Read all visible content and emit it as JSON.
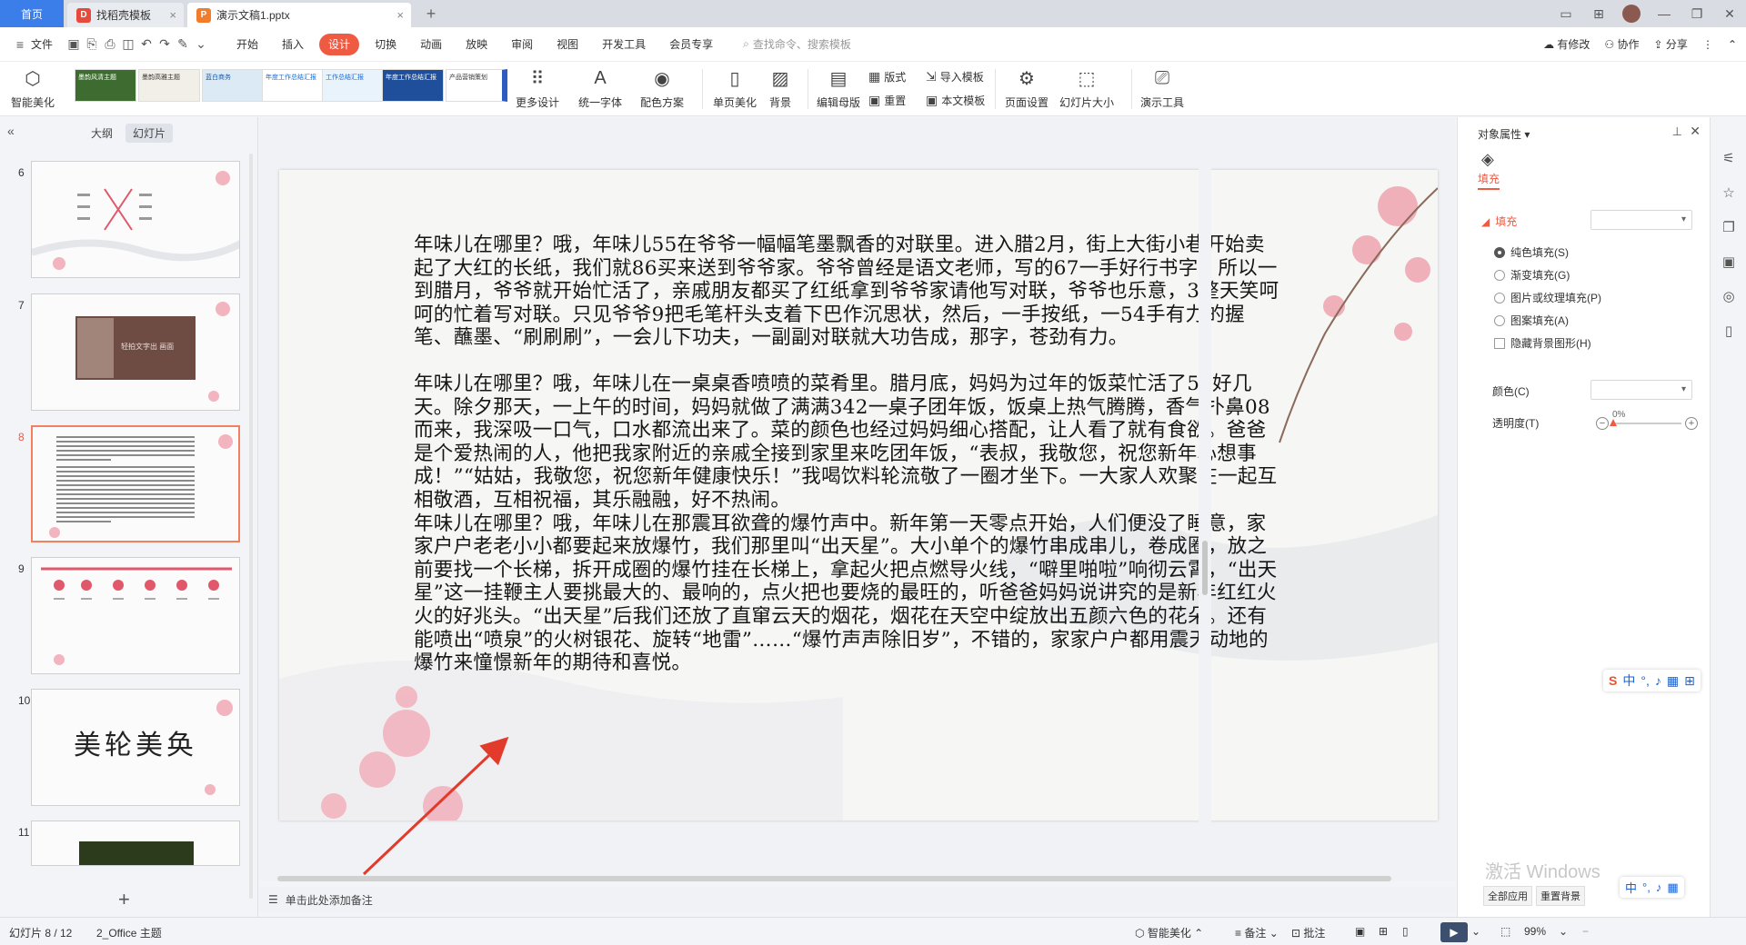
{
  "titlebar": {
    "tabs": [
      {
        "label": "首页"
      },
      {
        "label": "找稻壳模板"
      },
      {
        "label": "演示文稿1.pptx"
      }
    ]
  },
  "menu": {
    "file": "文件",
    "items": [
      "开始",
      "插入",
      "设计",
      "切换",
      "动画",
      "放映",
      "审阅",
      "视图",
      "开发工具",
      "会员专享"
    ],
    "active": "设计",
    "search_placeholder": "查找命令、搜索模板",
    "right": {
      "changes": "有修改",
      "collab": "协作",
      "share": "分享"
    }
  },
  "ribbon": {
    "smart_beautify": "智能美化",
    "template_thumbs": [
      "墨韵风清主题",
      "墨韵高雅主题",
      "蓝白商务",
      "年度工作总结汇报",
      "工作总结汇报",
      "年度工作总结汇报",
      "产品营销策划"
    ],
    "more_design": "更多设计",
    "unify_font": "统一字体",
    "color_scheme": "配色方案",
    "single_beautify": "单页美化",
    "background": "背景",
    "edit_master": "编辑母版",
    "layout": "版式",
    "reset": "重置",
    "import_template": "导入模板",
    "this_template": "本文模板",
    "page_setup": "页面设置",
    "slide_size": "幻灯片大小",
    "present_tools": "演示工具"
  },
  "left_panel": {
    "tab_outline": "大纲",
    "tab_slides": "幻灯片",
    "slides": [
      {
        "num": "6"
      },
      {
        "num": "7",
        "title": "轻拍文字出 画面"
      },
      {
        "num": "8",
        "selected": true
      },
      {
        "num": "9"
      },
      {
        "num": "10",
        "title": "美轮美奂"
      },
      {
        "num": "11"
      }
    ],
    "add": "+"
  },
  "slide": {
    "paragraphs": [
      "年味儿在哪里？哦，年味儿55在爷爷一幅幅笔墨飘香的对联里。进入腊2月，街上大街小巷开始卖起了大红的长纸，我们就86买来送到爷爷家。爷爷曾经是语文老师，写的67一手好行书字，所以一到腊月，爷爷就开始忙活了，亲戚朋友都买了红纸拿到爷爷家请他写对联，爷爷也乐意，3整天笑呵呵的忙着写对联。只见爷爷9把毛笔杆头支着下巴作沉思状，然后，一手按纸，一54手有力的握笔、蘸墨、“刷刷刷”，一会儿下功夫，一副副对联就大功告成，那字，苍劲有力。",
      "年味儿在哪里？哦，年味儿在一桌桌香喷喷的菜肴里。腊月底，妈妈为过年的饭菜忙活了56好几天。除夕那天，一上午的时间，妈妈就做了满满342一桌子团年饭，饭桌上热气腾腾，香气扑鼻08而来，我深吸一口气，口水都流出来了。菜的颜色也经过妈妈细心搭配，让人看了就有食欲。爸爸是个爱热闹的人，他把我家附近的亲戚全接到家里来吃团年饭，“表叔，我敬您，祝您新年心想事成！”“姑姑，我敬您，祝您新年健康快乐！”我喝饮料轮流敬了一圈才坐下。一大家人欢聚在一起互相敬酒，互相祝福，其乐融融，好不热闹。",
      "年味儿在哪里？哦，年味儿在那震耳欲聋的爆竹声中。新年第一天零点开始，人们便没了睡意，家家户户老老小小都要起来放爆竹，我们那里叫“出天星”。大小单个的爆竹串成串儿，卷成圈，放之前要找一个长梯，拆开成圈的爆竹挂在长梯上，拿起火把点燃导火线，“噼里啪啦”响彻云霄，“出天星”这一挂鞭主人要挑最大的、最响的，点火把也要烧的最旺的，听爸爸妈妈说讲究的是新年红红火火的好兆头。“出天星”后我们还放了直窜云天的烟花，烟花在天空中绽放出五颜六色的花朵。还有能喷出“喷泉”的火树银花、旋转“地雷”……“爆竹声声除旧岁”，不错的，家家户户都用震天动地的爆竹来憧憬新年的期待和喜悦。"
    ]
  },
  "notes_placeholder": "单击此处添加备注",
  "right_panel": {
    "title": "对象属性",
    "fill_tab": "填充",
    "section": "填充",
    "options": [
      "纯色填充(S)",
      "渐变填充(G)",
      "图片或纹理填充(P)",
      "图案填充(A)"
    ],
    "hide_bg": "隐藏背景图形(H)",
    "color_label": "颜色(C)",
    "transparency_label": "透明度(T)",
    "transparency_value": "0%",
    "watermark": "激活 Windows",
    "apply_all": "全部应用",
    "reset_bg": "重置背景"
  },
  "statusbar": {
    "slide_info": "幻灯片 8 / 12",
    "theme": "2_Office 主题",
    "smart_beautify": "智能美化",
    "notes": "备注",
    "comments": "批注",
    "zoom": "99%"
  },
  "colors": {
    "accent": "#ef5a43",
    "home_tab": "#3b7de9",
    "selected_slide_border": "#f08060",
    "annotation_arrow": "#e23b2b"
  }
}
